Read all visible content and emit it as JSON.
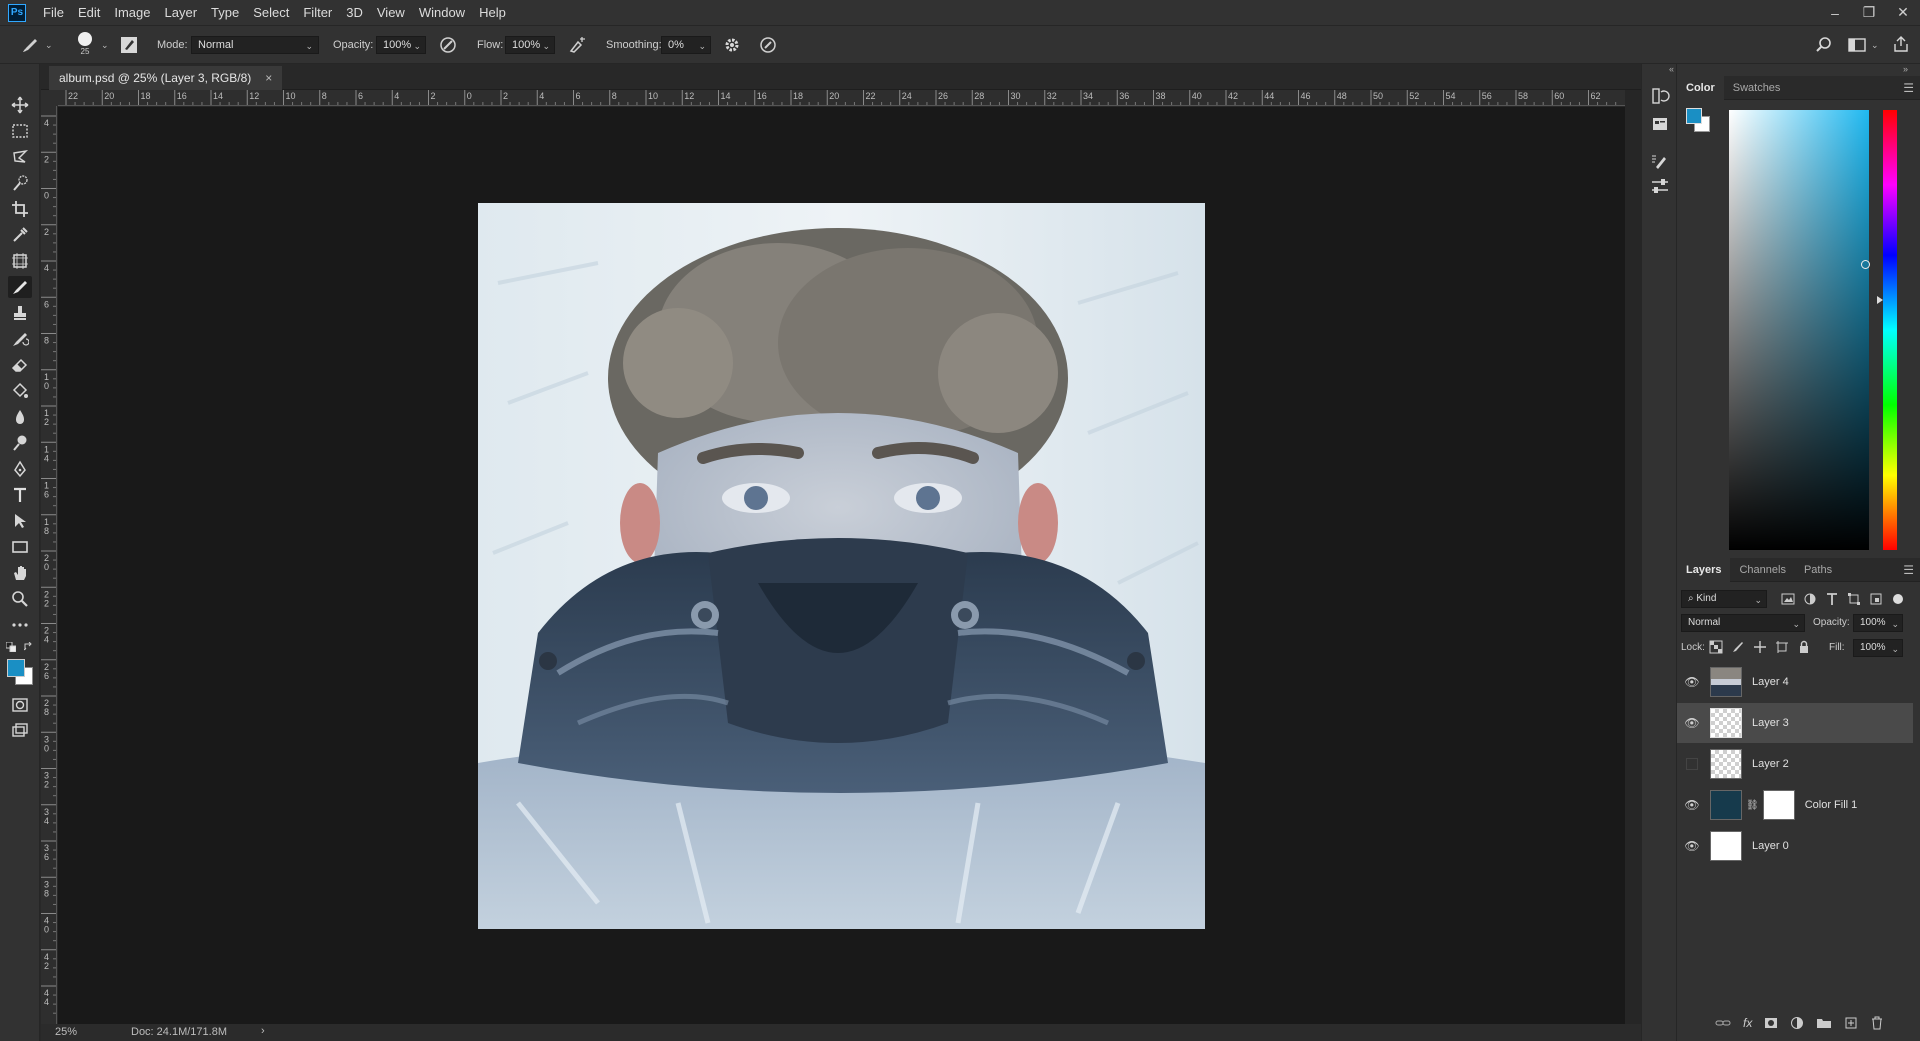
{
  "app": {
    "logo": "Ps"
  },
  "menu": [
    "File",
    "Edit",
    "Image",
    "Layer",
    "Type",
    "Select",
    "Filter",
    "3D",
    "View",
    "Window",
    "Help"
  ],
  "window_controls": {
    "minimize": "–",
    "restore": "❐",
    "close": "✕"
  },
  "options": {
    "brush_size": "25",
    "mode_label": "Mode:",
    "mode_value": "Normal",
    "opacity_label": "Opacity:",
    "opacity_value": "100%",
    "flow_label": "Flow:",
    "flow_value": "100%",
    "smoothing_label": "Smoothing:",
    "smoothing_value": "0%"
  },
  "document": {
    "tab_title": "album.psd @ 25% (Layer 3, RGB/8)",
    "tab_close": "×",
    "zoom": "25%",
    "doc_size": "Doc: 24.1M/171.8M",
    "status_arrow": "›"
  },
  "ruler": {
    "top_labels": [
      "22",
      "20",
      "18",
      "16",
      "14",
      "12",
      "10",
      "8",
      "6",
      "4",
      "2",
      "0",
      "2",
      "4",
      "6",
      "8",
      "10",
      "12",
      "14",
      "16",
      "18",
      "20",
      "22",
      "24",
      "26",
      "28",
      "30",
      "32",
      "34",
      "36",
      "38",
      "40",
      "42",
      "44",
      "46",
      "48",
      "50",
      "52",
      "54",
      "56",
      "58",
      "60",
      "62"
    ],
    "left_labels": [
      "4",
      "2",
      "0",
      "2",
      "4",
      "6",
      "8",
      "10",
      "12",
      "14",
      "16",
      "18",
      "20",
      "22",
      "24",
      "26",
      "28",
      "30",
      "32",
      "34",
      "36",
      "38",
      "40",
      "42",
      "44"
    ]
  },
  "color_panel": {
    "tabs": [
      "Color",
      "Swatches"
    ],
    "foreground": "#1a8fc4",
    "background": "#ffffff",
    "hue_color": "#1fb8f0"
  },
  "layers_panel": {
    "tabs": [
      "Layers",
      "Channels",
      "Paths"
    ],
    "filter_kind": "Kind",
    "blend_mode": "Normal",
    "opacity_label": "Opacity:",
    "opacity_value": "100%",
    "lock_label": "Lock:",
    "fill_label": "Fill:",
    "fill_value": "100%",
    "layers": [
      {
        "name": "Layer 4",
        "visible": true,
        "selected": false
      },
      {
        "name": "Layer 3",
        "visible": true,
        "selected": true
      },
      {
        "name": "Layer 2",
        "visible": false,
        "selected": false
      },
      {
        "name": "Color Fill 1",
        "visible": true,
        "selected": false
      },
      {
        "name": "Layer 0",
        "visible": true,
        "selected": false
      }
    ],
    "fill_swatch_color": "#163a4c"
  }
}
